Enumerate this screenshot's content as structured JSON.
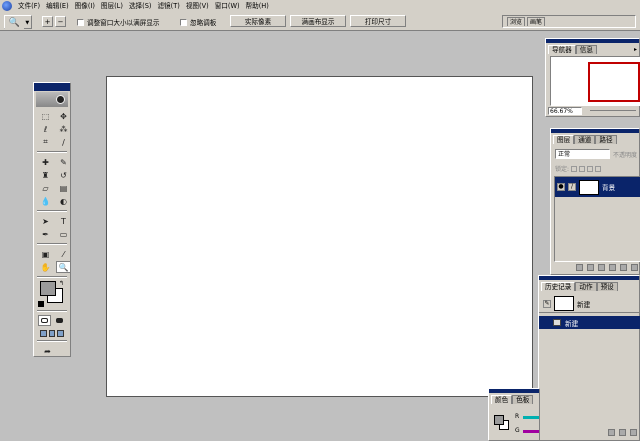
{
  "menubar": {
    "items": [
      "文件(F)",
      "编辑(E)",
      "图像(I)",
      "图层(L)",
      "选择(S)",
      "滤镜(T)",
      "视图(V)",
      "窗口(W)",
      "帮助(H)"
    ]
  },
  "options": {
    "tool_icon": "zoom-icon",
    "resize_windows_label": "调整窗口大小以满屏显示",
    "ignore_palettes_label": "忽略调板",
    "actual_pixels": "实际像素",
    "fit_on_screen": "满画布显示",
    "print_size": "打印尺寸",
    "palette_well_tabs": [
      "浏览",
      "画笔"
    ]
  },
  "colors": {
    "titlebar": "#0a246a",
    "chrome": "#d4d0c8",
    "workspace": "#c0c0c0",
    "nav_box": "#c00000",
    "foreground": "#9a9a9a",
    "background": "#ffffff"
  },
  "navigator": {
    "tabs": [
      "导航器",
      "信息"
    ],
    "zoom": "66.67%"
  },
  "layers": {
    "tabs": [
      "图层",
      "通道",
      "路径"
    ],
    "blend_mode": "正常",
    "opacity_label": "不透明度",
    "lock_label": "锁定:",
    "layer_name": "背景"
  },
  "history": {
    "tabs": [
      "历史记录",
      "动作",
      "预设"
    ],
    "snapshot_name": "新建",
    "state_name": "新建"
  },
  "color": {
    "tabs": [
      "颜色",
      "色板"
    ],
    "channels": [
      "R",
      "G"
    ]
  }
}
